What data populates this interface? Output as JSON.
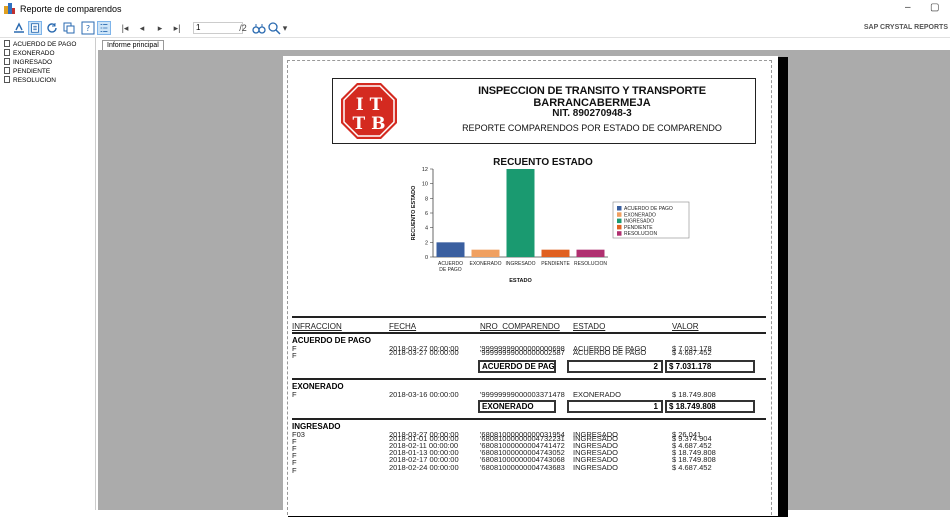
{
  "window": {
    "title": "Reporte de comparendos",
    "minimize_label": "–",
    "restore_label": "▢"
  },
  "toolbar": {
    "nav_first": "|◂",
    "nav_prev": "◂",
    "nav_next": "▸",
    "nav_last": "▸|",
    "page_value": "1",
    "page_total": "/2",
    "zoom_label": "▾",
    "brand": "SAP CRYSTAL REPORTS"
  },
  "tree": {
    "items": [
      {
        "label": "ACUERDO DE PAGO"
      },
      {
        "label": "EXONERADO"
      },
      {
        "label": "INGRESADO"
      },
      {
        "label": "PENDIENTE"
      },
      {
        "label": "RESOLUCION"
      }
    ]
  },
  "tabs": {
    "main": "Informe principal"
  },
  "report": {
    "logo_top": "I T",
    "logo_bottom": "T B",
    "title1": "INSPECCION DE TRANSITO Y TRANSPORTE",
    "title2": "BARRANCABERMEJA",
    "title3": "NIT. 890270948-3",
    "subtitle": "REPORTE COMPARENDOS POR ESTADO DE COMPARENDO",
    "columns": {
      "infraccion": "INFRACCION",
      "fecha": "FECHA",
      "nro": "NRO_COMPARENDO",
      "estado": "ESTADO",
      "valor": "VALOR"
    },
    "groups": [
      {
        "name": "ACUERDO DE PAGO",
        "rows": [
          {
            "inf": "F",
            "fecha": "2018-03-27 00:00:00",
            "nro": "'99999999000000000698",
            "estado": "ACUERDO DE PAGO",
            "valor": "$ 7.031.178"
          },
          {
            "inf": "F",
            "fecha": "2018-03-27 00:00:00",
            "nro": "'99999999000000002587",
            "estado": "ACUERDO DE PAGO",
            "valor": "$ 4.687.452"
          }
        ],
        "sum_name": "ACUERDO DE PAGO",
        "sum_count": "2",
        "sum_value": "$ 7.031.178"
      },
      {
        "name": "EXONERADO",
        "rows": [
          {
            "inf": "F",
            "fecha": "2018-03-16 00:00:00",
            "nro": "'99999999000003371478",
            "estado": "EXONERADO",
            "valor": "$ 18.749.808"
          }
        ],
        "sum_name": "EXONERADO",
        "sum_count": "1",
        "sum_value": "$ 18.749.808"
      },
      {
        "name": "INGRESADO",
        "rows": [
          {
            "inf": "F03",
            "fecha": "2018-03-27 00:00:00",
            "nro": "'68081000000000031954",
            "estado": "INGRESADO",
            "valor": "$ 26.041"
          },
          {
            "inf": "F",
            "fecha": "2018-01-01 00:00:00",
            "nro": "'68081000000004732231",
            "estado": "INGRESADO",
            "valor": "$ 9.374.904"
          },
          {
            "inf": "F",
            "fecha": "2018-02-11 00:00:00",
            "nro": "'68081000000004741472",
            "estado": "INGRESADO",
            "valor": "$ 4.687.452"
          },
          {
            "inf": "F",
            "fecha": "2018-01-13 00:00:00",
            "nro": "'68081000000004743052",
            "estado": "INGRESADO",
            "valor": "$ 18.749.808"
          },
          {
            "inf": "F",
            "fecha": "2018-02-17 00:00:00",
            "nro": "'68081000000004743068",
            "estado": "INGRESADO",
            "valor": "$ 18.749.808"
          },
          {
            "inf": "F",
            "fecha": "2018-02-24 00:00:00",
            "nro": "'68081000000004743683",
            "estado": "INGRESADO",
            "valor": "$ 4.687.452"
          }
        ]
      }
    ]
  },
  "chart_data": {
    "type": "bar",
    "title": "RECUENTO ESTADO",
    "xlabel": "ESTADO",
    "ylabel": "RECUENTO ESTADO",
    "categories": [
      "ACUERDO DE PAGO",
      "EXONERADO",
      "INGRESADO",
      "PENDIENTE",
      "RESOLUCION"
    ],
    "values": [
      2,
      1,
      12,
      1,
      1
    ],
    "colors": [
      "#3a5fa0",
      "#f0a060",
      "#1a9a70",
      "#e06020",
      "#b03070"
    ],
    "ylim": [
      0,
      12
    ],
    "yticks": [
      0,
      2,
      4,
      6,
      8,
      10,
      12
    ],
    "legend": [
      "ACUERDO DE PAGO",
      "EXONERADO",
      "INGRESADO",
      "PENDIENTE",
      "RESOLUCION"
    ],
    "legend_position": "right",
    "grid": false
  }
}
